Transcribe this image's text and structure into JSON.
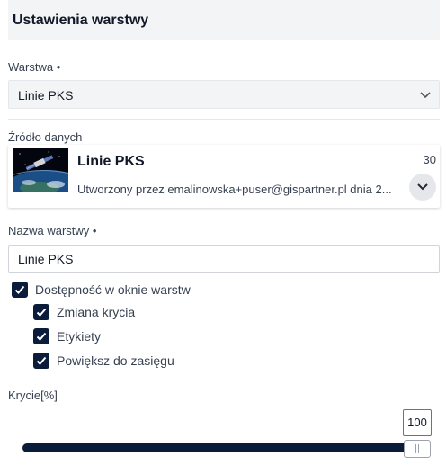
{
  "header": {
    "title": "Ustawienia warstwy"
  },
  "layer_select": {
    "label": "Warstwa •",
    "value": "Linie PKS",
    "icon": "chevron-down-icon"
  },
  "data_source": {
    "label": "Źródło danych",
    "title": "Linie PKS",
    "count": "30",
    "description": "Utworzony przez emalinowska+puser@gispartner.pl dnia 2...",
    "expand_icon": "chevron-down-icon"
  },
  "layer_name": {
    "label": "Nazwa warstwy •",
    "value": "Linie PKS"
  },
  "checkboxes": [
    {
      "label": "Dostępność w oknie warstw",
      "checked": true
    },
    {
      "label": "Zmiana krycia",
      "checked": true
    },
    {
      "label": "Etykiety",
      "checked": true
    },
    {
      "label": "Powiększ do zasięgu",
      "checked": true
    }
  ],
  "opacity": {
    "label": "Krycie[%]",
    "value": "100"
  },
  "colors": {
    "accent": "#0b1b3a",
    "header_bg": "#f3f4f6"
  }
}
